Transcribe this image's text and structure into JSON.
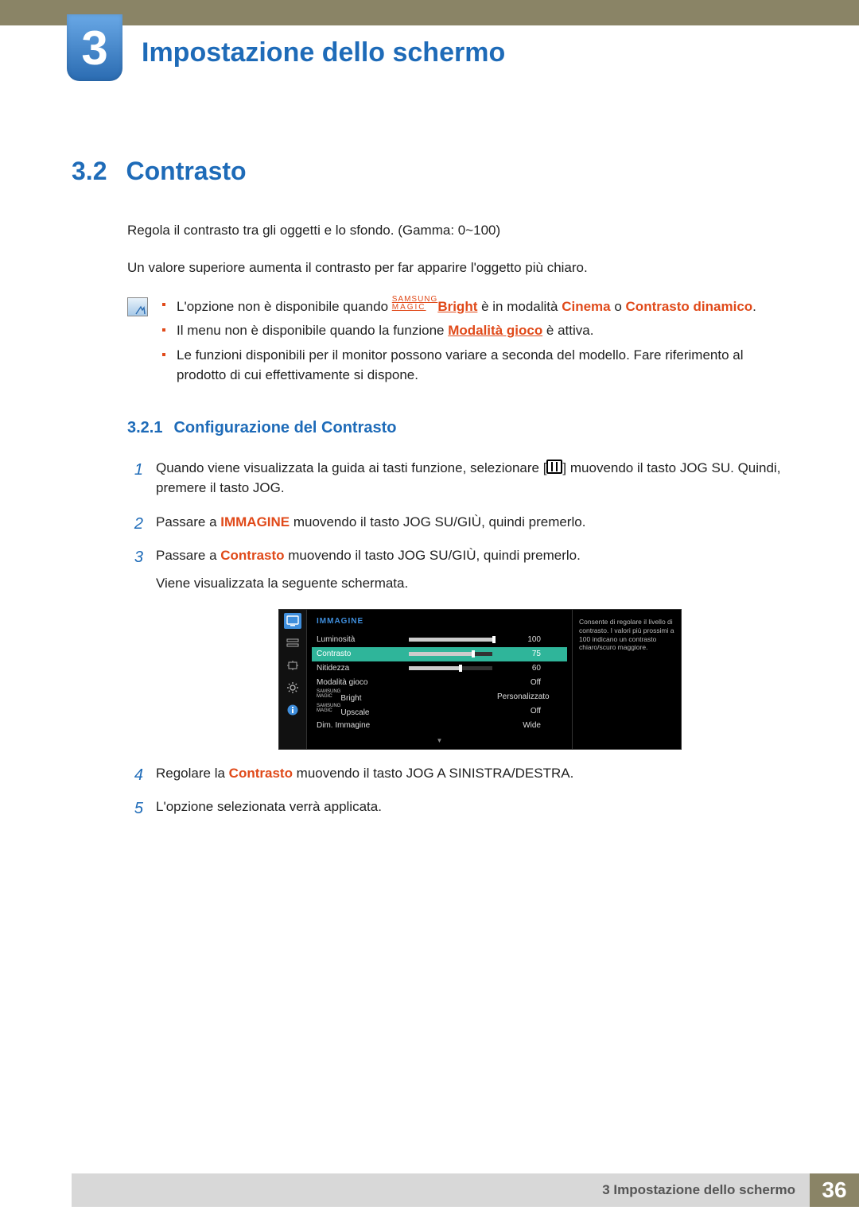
{
  "chapter": {
    "num": "3",
    "title": "Impostazione dello schermo"
  },
  "section": {
    "num": "3.2",
    "title": "Contrasto"
  },
  "para1": "Regola il contrasto tra gli oggetti e lo sfondo. (Gamma: 0~100)",
  "para2": "Un valore superiore aumenta il contrasto per far apparire l'oggetto più chiaro.",
  "notes": {
    "n1_a": "L'opzione non è disponibile quando ",
    "n1_brand1": "SAMSUNG",
    "n1_brand2": "MAGIC",
    "n1_bright": "Bright",
    "n1_b": " è in modalità ",
    "n1_c": "Cinema",
    "n1_d": " o ",
    "n1_e": "Contrasto dinamico",
    "n1_f": ".",
    "n2_a": "Il menu non è disponibile quando la funzione ",
    "n2_b": "Modalità gioco",
    "n2_c": " è attiva.",
    "n3": "Le funzioni disponibili per il monitor possono variare a seconda del modello. Fare riferimento al prodotto di cui effettivamente si dispone."
  },
  "subsection": {
    "num": "3.2.1",
    "title": "Configurazione del Contrasto"
  },
  "steps": {
    "s1a": "Quando viene visualizzata la guida ai tasti funzione, selezionare [",
    "s1b": "] muovendo il tasto JOG SU. Quindi, premere il tasto JOG.",
    "s2a": "Passare a ",
    "s2b": "IMMAGINE",
    "s2c": " muovendo il tasto JOG SU/GIÙ, quindi premerlo.",
    "s3a": "Passare a ",
    "s3b": "Contrasto",
    "s3c": " muovendo il tasto JOG SU/GIÙ, quindi premerlo.",
    "s3d": "Viene visualizzata la seguente schermata.",
    "s4a": "Regolare la ",
    "s4b": "Contrasto",
    "s4c": " muovendo il tasto JOG A SINISTRA/DESTRA.",
    "s5": "L'opzione selezionata verrà applicata."
  },
  "osd": {
    "title": "IMMAGINE",
    "rows": {
      "r1": {
        "label": "Luminosità",
        "val": "100",
        "pct": 100
      },
      "r2": {
        "label": "Contrasto",
        "val": "75",
        "pct": 75
      },
      "r3": {
        "label": "Nitidezza",
        "val": "60",
        "pct": 60
      },
      "r4": {
        "label": "Modalità gioco",
        "val": "Off"
      },
      "r5": {
        "brand1": "SAMSUNG",
        "brand2": "MAGIC",
        "label": "Bright",
        "val": "Personalizzato"
      },
      "r6": {
        "brand1": "SAMSUNG",
        "brand2": "MAGIC",
        "label": "Upscale",
        "val": "Off"
      },
      "r7": {
        "label": "Dim. Immagine",
        "val": "Wide"
      }
    },
    "desc": "Consente di regolare il livello di contrasto. I valori più prossimi a 100 indicano un contrasto chiaro/scuro maggiore."
  },
  "footer": {
    "text": "3 Impostazione dello schermo",
    "page": "36"
  }
}
